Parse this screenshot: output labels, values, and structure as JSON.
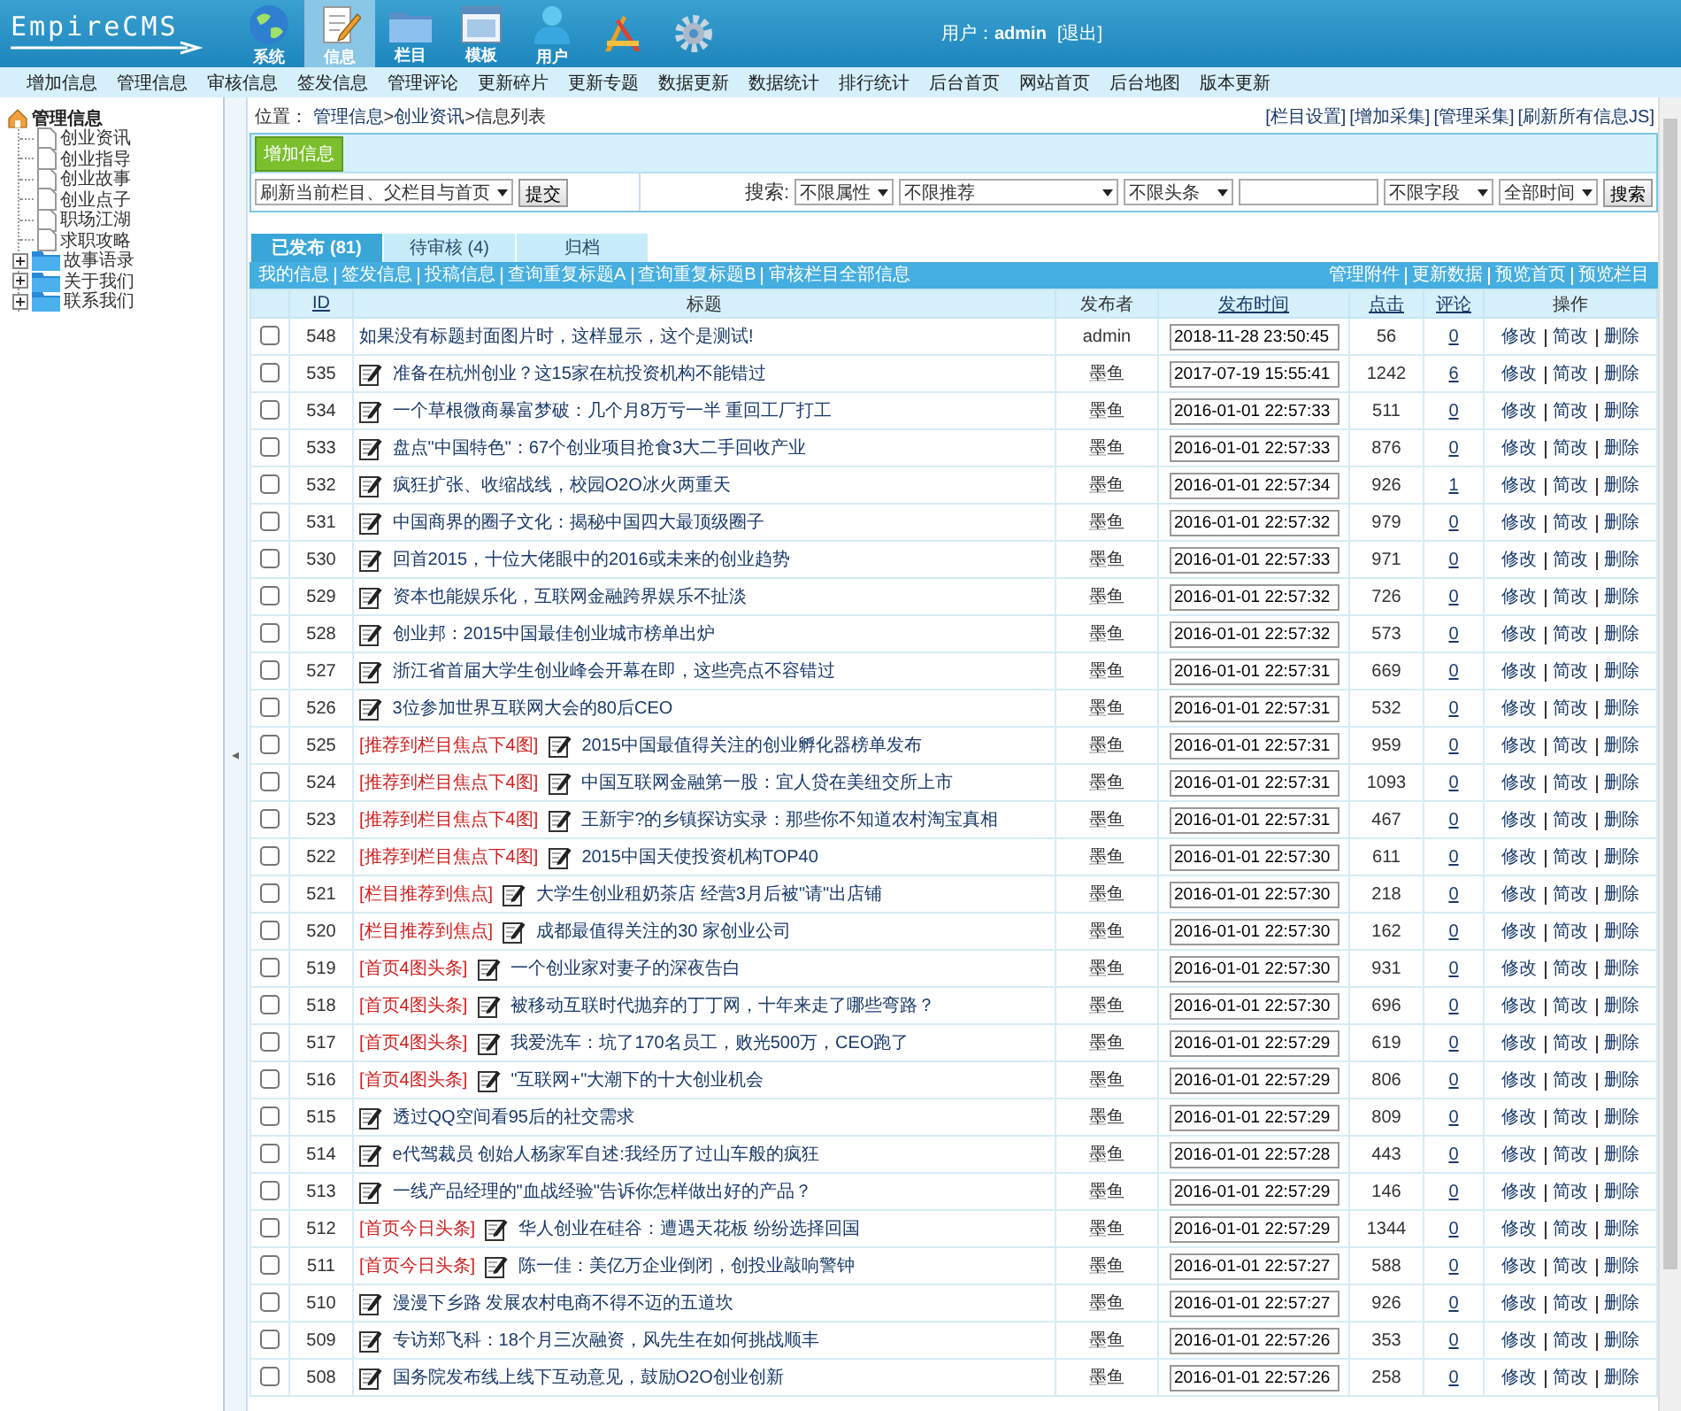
{
  "header": {
    "logo": "EmpireCMS",
    "nav": [
      {
        "label": "系统",
        "selected": false
      },
      {
        "label": "信息",
        "selected": true
      },
      {
        "label": "栏目",
        "selected": false
      },
      {
        "label": "模板",
        "selected": false
      },
      {
        "label": "用户",
        "selected": false
      },
      {
        "selected": false
      },
      {
        "selected": false
      }
    ],
    "user_label": "用户：",
    "user_name": "admin",
    "logout": "[退出]"
  },
  "menu": [
    "增加信息",
    "管理信息",
    "审核信息",
    "签发信息",
    "管理评论",
    "更新碎片",
    "更新专题",
    "数据更新",
    "数据统计",
    "排行统计",
    "后台首页",
    "网站首页",
    "后台地图",
    "版本更新"
  ],
  "sidebar": {
    "tree": [
      {
        "label": "管理信息",
        "kind": "root",
        "expanded": true,
        "children": [
          {
            "label": "创业资讯",
            "kind": "page"
          },
          {
            "label": "创业指导",
            "kind": "page"
          },
          {
            "label": "创业故事",
            "kind": "page"
          },
          {
            "label": "创业点子",
            "kind": "page"
          },
          {
            "label": "职场江湖",
            "kind": "page"
          },
          {
            "label": "求职攻略",
            "kind": "page"
          },
          {
            "label": "故事语录",
            "kind": "folder",
            "expanded": false
          },
          {
            "label": "关于我们",
            "kind": "folder",
            "expanded": false
          },
          {
            "label": "联系我们",
            "kind": "folder",
            "expanded": false
          }
        ]
      }
    ],
    "splitter_arrow": "◂"
  },
  "breadcrumb": {
    "prefix": "位置：",
    "items": [
      "管理信息",
      "创业资讯",
      "信息列表"
    ],
    "separator": ">"
  },
  "top_links": [
    "[栏目设置]",
    "[增加采集]",
    "[管理采集]",
    "[刷新所有信息JS]"
  ],
  "toolbar": {
    "add_button": "增加信息",
    "refresh_select": "刷新当前栏目、父栏目与首页",
    "submit_button": "提交",
    "search_label": "搜索:",
    "filters": [
      "不限属性",
      "不限推荐",
      "不限头条"
    ],
    "field_select": "不限字段",
    "time_select": "全部时间",
    "search_button": "搜索"
  },
  "tabs": [
    {
      "label": "已发布 (81)",
      "selected": true
    },
    {
      "label": "待审核 (4)",
      "selected": false
    },
    {
      "label": "归档",
      "selected": false
    }
  ],
  "list_links_left": [
    "我的信息",
    "签发信息",
    "投稿信息",
    "查询重复标题A",
    "查询重复标题B",
    "审核栏目全部信息"
  ],
  "list_links_right": [
    "管理附件",
    "更新数据",
    "预览首页",
    "预览栏目"
  ],
  "table": {
    "columns": [
      {
        "label": "ID",
        "sortable": true
      },
      {
        "label": "标题",
        "sortable": false
      },
      {
        "label": "发布者",
        "sortable": false
      },
      {
        "label": "发布时间",
        "sortable": true
      },
      {
        "label": "点击",
        "sortable": true
      },
      {
        "label": "评论",
        "sortable": true
      },
      {
        "label": "操作",
        "sortable": false
      }
    ],
    "rows": [
      {
        "checked": false,
        "id": "548",
        "has_icon": false,
        "title": "如果没有标题封面图片时，这样显示，这个是测试!",
        "publisher": "admin",
        "time": "2018-11-28 23:50:45",
        "clicks": "56",
        "comments": "0",
        "actions": [
          "修改",
          "简改",
          "删除"
        ]
      },
      {
        "checked": false,
        "id": "535",
        "has_icon": true,
        "title": "准备在杭州创业？这15家在杭投资机构不能错过",
        "publisher": "墨鱼",
        "time": "2017-07-19 15:55:41",
        "clicks": "1242",
        "comments": "6",
        "actions": [
          "修改",
          "简改",
          "删除"
        ]
      },
      {
        "checked": false,
        "id": "534",
        "has_icon": true,
        "title": "一个草根微商暴富梦破：几个月8万亏一半 重回工厂打工",
        "publisher": "墨鱼",
        "time": "2016-01-01 22:57:33",
        "clicks": "511",
        "comments": "0",
        "actions": [
          "修改",
          "简改",
          "删除"
        ]
      },
      {
        "checked": false,
        "id": "533",
        "has_icon": true,
        "title": "盘点\"中国特色\"：67个创业项目抢食3大二手回收产业",
        "publisher": "墨鱼",
        "time": "2016-01-01 22:57:33",
        "clicks": "876",
        "comments": "0",
        "actions": [
          "修改",
          "简改",
          "删除"
        ]
      },
      {
        "checked": false,
        "id": "532",
        "has_icon": true,
        "title": "疯狂扩张、收缩战线，校园O2O冰火两重天",
        "publisher": "墨鱼",
        "time": "2016-01-01 22:57:34",
        "clicks": "926",
        "comments": "1",
        "actions": [
          "修改",
          "简改",
          "删除"
        ]
      },
      {
        "checked": false,
        "id": "531",
        "has_icon": true,
        "title": "中国商界的圈子文化：揭秘中国四大最顶级圈子",
        "publisher": "墨鱼",
        "time": "2016-01-01 22:57:32",
        "clicks": "979",
        "comments": "0",
        "actions": [
          "修改",
          "简改",
          "删除"
        ]
      },
      {
        "checked": false,
        "id": "530",
        "has_icon": true,
        "title": "回首2015，十位大佬眼中的2016或未来的创业趋势",
        "publisher": "墨鱼",
        "time": "2016-01-01 22:57:33",
        "clicks": "971",
        "comments": "0",
        "actions": [
          "修改",
          "简改",
          "删除"
        ]
      },
      {
        "checked": false,
        "id": "529",
        "has_icon": true,
        "title": "资本也能娱乐化，互联网金融跨界娱乐不扯淡",
        "publisher": "墨鱼",
        "time": "2016-01-01 22:57:32",
        "clicks": "726",
        "comments": "0",
        "actions": [
          "修改",
          "简改",
          "删除"
        ]
      },
      {
        "checked": false,
        "id": "528",
        "has_icon": true,
        "title": "创业邦：2015中国最佳创业城市榜单出炉",
        "publisher": "墨鱼",
        "time": "2016-01-01 22:57:32",
        "clicks": "573",
        "comments": "0",
        "actions": [
          "修改",
          "简改",
          "删除"
        ]
      },
      {
        "checked": false,
        "id": "527",
        "has_icon": true,
        "title": "浙江省首届大学生创业峰会开幕在即，这些亮点不容错过",
        "publisher": "墨鱼",
        "time": "2016-01-01 22:57:31",
        "clicks": "669",
        "comments": "0",
        "actions": [
          "修改",
          "简改",
          "删除"
        ]
      },
      {
        "checked": false,
        "id": "526",
        "has_icon": true,
        "title": "3位参加世界互联网大会的80后CEO",
        "publisher": "墨鱼",
        "time": "2016-01-01 22:57:31",
        "clicks": "532",
        "comments": "0",
        "actions": [
          "修改",
          "简改",
          "删除"
        ]
      },
      {
        "checked": false,
        "id": "525",
        "tag": "[推荐到栏目焦点下4图]",
        "has_icon": true,
        "title": "2015中国最值得关注的创业孵化器榜单发布",
        "publisher": "墨鱼",
        "time": "2016-01-01 22:57:31",
        "clicks": "959",
        "comments": "0",
        "actions": [
          "修改",
          "简改",
          "删除"
        ]
      },
      {
        "checked": false,
        "id": "524",
        "tag": "[推荐到栏目焦点下4图]",
        "has_icon": true,
        "title": "中国互联网金融第一股：宜人贷在美纽交所上市",
        "publisher": "墨鱼",
        "time": "2016-01-01 22:57:31",
        "clicks": "1093",
        "comments": "0",
        "actions": [
          "修改",
          "简改",
          "删除"
        ]
      },
      {
        "checked": false,
        "id": "523",
        "tag": "[推荐到栏目焦点下4图]",
        "has_icon": true,
        "title": "王新宇?的乡镇探访实录：那些你不知道农村淘宝真相",
        "publisher": "墨鱼",
        "time": "2016-01-01 22:57:31",
        "clicks": "467",
        "comments": "0",
        "actions": [
          "修改",
          "简改",
          "删除"
        ]
      },
      {
        "checked": false,
        "id": "522",
        "tag": "[推荐到栏目焦点下4图]",
        "has_icon": true,
        "title": "2015中国天使投资机构TOP40",
        "publisher": "墨鱼",
        "time": "2016-01-01 22:57:30",
        "clicks": "611",
        "comments": "0",
        "actions": [
          "修改",
          "简改",
          "删除"
        ]
      },
      {
        "checked": false,
        "id": "521",
        "tag": "[栏目推荐到焦点]",
        "has_icon": true,
        "title": "大学生创业租奶茶店 经营3月后被\"请\"出店铺",
        "publisher": "墨鱼",
        "time": "2016-01-01 22:57:30",
        "clicks": "218",
        "comments": "0",
        "actions": [
          "修改",
          "简改",
          "删除"
        ]
      },
      {
        "checked": false,
        "id": "520",
        "tag": "[栏目推荐到焦点]",
        "has_icon": true,
        "title": "成都最值得关注的30 家创业公司",
        "publisher": "墨鱼",
        "time": "2016-01-01 22:57:30",
        "clicks": "162",
        "comments": "0",
        "actions": [
          "修改",
          "简改",
          "删除"
        ]
      },
      {
        "checked": false,
        "id": "519",
        "tag": "[首页4图头条]",
        "has_icon": true,
        "title": "一个创业家对妻子的深夜告白",
        "publisher": "墨鱼",
        "time": "2016-01-01 22:57:30",
        "clicks": "931",
        "comments": "0",
        "actions": [
          "修改",
          "简改",
          "删除"
        ]
      },
      {
        "checked": false,
        "id": "518",
        "tag": "[首页4图头条]",
        "has_icon": true,
        "title": "被移动互联时代抛弃的丁丁网，十年来走了哪些弯路？",
        "publisher": "墨鱼",
        "time": "2016-01-01 22:57:30",
        "clicks": "696",
        "comments": "0",
        "actions": [
          "修改",
          "简改",
          "删除"
        ]
      },
      {
        "checked": false,
        "id": "517",
        "tag": "[首页4图头条]",
        "has_icon": true,
        "title": "我爱洗车：坑了170名员工，败光500万，CEO跑了",
        "publisher": "墨鱼",
        "time": "2016-01-01 22:57:29",
        "clicks": "619",
        "comments": "0",
        "actions": [
          "修改",
          "简改",
          "删除"
        ]
      },
      {
        "checked": false,
        "id": "516",
        "tag": "[首页4图头条]",
        "has_icon": true,
        "title": "\"互联网+\"大潮下的十大创业机会",
        "publisher": "墨鱼",
        "time": "2016-01-01 22:57:29",
        "clicks": "806",
        "comments": "0",
        "actions": [
          "修改",
          "简改",
          "删除"
        ]
      },
      {
        "checked": false,
        "id": "515",
        "has_icon": true,
        "title": "透过QQ空间看95后的社交需求",
        "publisher": "墨鱼",
        "time": "2016-01-01 22:57:29",
        "clicks": "809",
        "comments": "0",
        "actions": [
          "修改",
          "简改",
          "删除"
        ]
      },
      {
        "checked": false,
        "id": "514",
        "has_icon": true,
        "title": "e代驾裁员 创始人杨家军自述:我经历了过山车般的疯狂",
        "publisher": "墨鱼",
        "time": "2016-01-01 22:57:28",
        "clicks": "443",
        "comments": "0",
        "actions": [
          "修改",
          "简改",
          "删除"
        ]
      },
      {
        "checked": false,
        "id": "513",
        "has_icon": true,
        "title": "一线产品经理的\"血战经验\"告诉你怎样做出好的产品？",
        "publisher": "墨鱼",
        "time": "2016-01-01 22:57:29",
        "clicks": "146",
        "comments": "0",
        "actions": [
          "修改",
          "简改",
          "删除"
        ]
      },
      {
        "checked": false,
        "id": "512",
        "tag": "[首页今日头条]",
        "has_icon": true,
        "title": "华人创业在硅谷：遭遇天花板 纷纷选择回国",
        "publisher": "墨鱼",
        "time": "2016-01-01 22:57:29",
        "clicks": "1344",
        "comments": "0",
        "actions": [
          "修改",
          "简改",
          "删除"
        ]
      },
      {
        "checked": false,
        "id": "511",
        "tag": "[首页今日头条]",
        "has_icon": true,
        "title": "陈一佳：美亿万企业倒闭，创投业敲响警钟",
        "publisher": "墨鱼",
        "time": "2016-01-01 22:57:27",
        "clicks": "588",
        "comments": "0",
        "actions": [
          "修改",
          "简改",
          "删除"
        ]
      },
      {
        "checked": false,
        "id": "510",
        "has_icon": true,
        "title": "漫漫下乡路 发展农村电商不得不迈的五道坎",
        "publisher": "墨鱼",
        "time": "2016-01-01 22:57:27",
        "clicks": "926",
        "comments": "0",
        "actions": [
          "修改",
          "简改",
          "删除"
        ]
      },
      {
        "checked": false,
        "id": "509",
        "has_icon": true,
        "title": "专访郑飞科：18个月三次融资，风先生在如何挑战顺丰",
        "publisher": "墨鱼",
        "time": "2016-01-01 22:57:26",
        "clicks": "353",
        "comments": "0",
        "actions": [
          "修改",
          "简改",
          "删除"
        ]
      },
      {
        "checked": false,
        "id": "508",
        "has_icon": true,
        "title": "国务院发布线上线下互动意见，鼓励O2O创业创新",
        "publisher": "墨鱼",
        "time": "2016-01-01 22:57:26",
        "clicks": "258",
        "comments": "0",
        "actions": [
          "修改",
          "简改",
          "删除"
        ]
      }
    ]
  }
}
